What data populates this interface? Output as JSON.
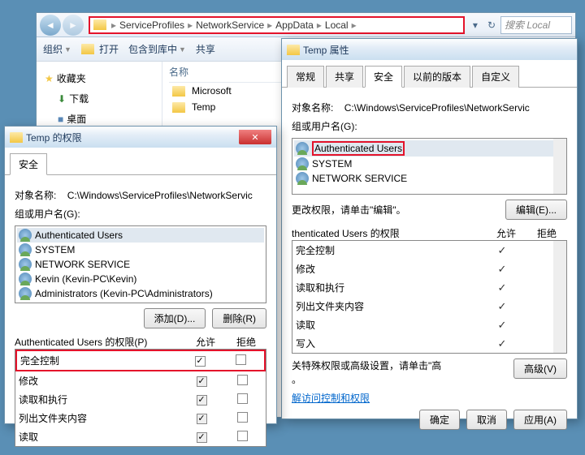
{
  "explorer": {
    "breadcrumb": [
      "ServiceProfiles",
      "NetworkService",
      "AppData",
      "Local"
    ],
    "search_placeholder": "搜索 Local",
    "toolbar": {
      "organize": "组织",
      "open": "打开",
      "include": "包含到库中",
      "share": "共享"
    },
    "sidebar": {
      "favorites": "收藏夹",
      "downloads": "下载",
      "desktop": "桌面"
    },
    "column_name": "名称",
    "files": [
      "Microsoft",
      "Temp"
    ]
  },
  "props": {
    "title": "Temp 属性",
    "tabs": {
      "general": "常规",
      "share": "共享",
      "security": "安全",
      "prev": "以前的版本",
      "custom": "自定义"
    },
    "object_label": "对象名称:",
    "object_path": "C:\\Windows\\ServiceProfiles\\NetworkServic",
    "groups_label": "组或用户名(G):",
    "users": [
      "Authenticated Users",
      "SYSTEM",
      "NETWORK SERVICE"
    ],
    "edit_hint": "更改权限，请单击\"编辑\"。",
    "edit_btn": "编辑(E)...",
    "perm_title": "thenticated Users 的权限",
    "allow": "允许",
    "deny": "拒绝",
    "perms": [
      "完全控制",
      "修改",
      "读取和执行",
      "列出文件夹内容",
      "读取",
      "写入"
    ],
    "special_hint": "关特殊权限或高级设置，请单击\"高",
    "special_hint2": "。",
    "adv_btn": "高级(V)",
    "link": "解访问控制和权限",
    "ok": "确定",
    "cancel": "取消",
    "apply": "应用(A)"
  },
  "perm": {
    "title": "Temp 的权限",
    "tab": "安全",
    "object_label": "对象名称:",
    "object_path": "C:\\Windows\\ServiceProfiles\\NetworkServic",
    "groups_label": "组或用户名(G):",
    "users": [
      "Authenticated Users",
      "SYSTEM",
      "NETWORK SERVICE",
      "Kevin (Kevin-PC\\Kevin)",
      "Administrators (Kevin-PC\\Administrators)"
    ],
    "add_btn": "添加(D)...",
    "remove_btn": "删除(R)",
    "perm_title": "Authenticated Users 的权限(P)",
    "allow": "允许",
    "deny": "拒绝",
    "perms": [
      "完全控制",
      "修改",
      "读取和执行",
      "列出文件夹内容",
      "读取"
    ]
  }
}
